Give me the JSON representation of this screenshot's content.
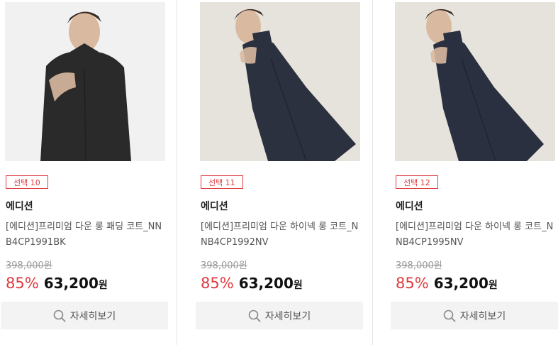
{
  "products": [
    {
      "badge": "선택 10",
      "brand": "에디션",
      "name": "[에디션]프리미엄 다운 롱 패딩 코트_NNB4CP1991BK",
      "original_price": "398,000원",
      "discount_rate": "85%",
      "sale_price": "63,200",
      "currency": "원",
      "detail_label": "자세히보기",
      "coat_color": "#2a2a2a",
      "bg_color": "#f1f1f1"
    },
    {
      "badge": "선택 11",
      "brand": "에디션",
      "name": "[에디션]프리미엄 다운 하이넥 롱 코트_NNB4CP1992NV",
      "original_price": "398,000원",
      "discount_rate": "85%",
      "sale_price": "63,200",
      "currency": "원",
      "detail_label": "자세히보기",
      "coat_color": "#2c3140",
      "bg_color": "#e6e3dc"
    },
    {
      "badge": "선택 12",
      "brand": "에디션",
      "name": "[에디션]프리미엄 다운 하이넥 롱 코트_NNB4CP1995NV",
      "original_price": "398,000원",
      "discount_rate": "85%",
      "sale_price": "63,200",
      "currency": "원",
      "detail_label": "자세히보기",
      "coat_color": "#2b3040",
      "bg_color": "#e6e3dc"
    }
  ],
  "colors": {
    "accent": "#e0393e",
    "button_bg": "#f3f3f3"
  },
  "icons": {
    "detail": "search-icon"
  }
}
